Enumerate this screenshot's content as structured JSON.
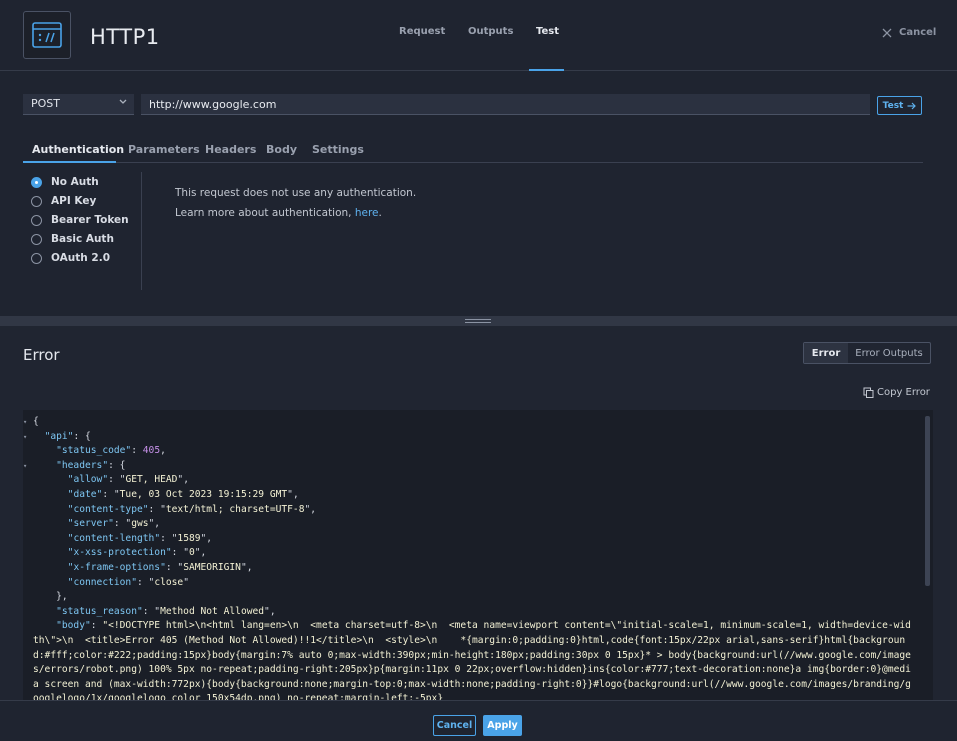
{
  "header": {
    "icon": "http-api-icon",
    "title": "HTTP1",
    "tabs": [
      {
        "label": "Request",
        "active": false
      },
      {
        "label": "Outputs",
        "active": false
      },
      {
        "label": "Test",
        "active": true
      }
    ],
    "cancel_label": "Cancel"
  },
  "request": {
    "method": "POST",
    "url": "http://www.google.com",
    "test_label": "Test"
  },
  "sub_tabs": [
    {
      "label": "Authentication",
      "active": true
    },
    {
      "label": "Parameters",
      "active": false
    },
    {
      "label": "Headers",
      "active": false
    },
    {
      "label": "Body",
      "active": false
    },
    {
      "label": "Settings",
      "active": false
    }
  ],
  "auth": {
    "options": [
      {
        "label": "No Auth",
        "selected": true
      },
      {
        "label": "API Key",
        "selected": false
      },
      {
        "label": "Bearer Token",
        "selected": false
      },
      {
        "label": "Basic Auth",
        "selected": false
      },
      {
        "label": "OAuth 2.0",
        "selected": false
      }
    ],
    "description": "This request does not use any authentication.",
    "learn_more_prefix": "Learn more about authentication, ",
    "learn_more_link": "here",
    "learn_more_suffix": "."
  },
  "error": {
    "title": "Error",
    "toggle": {
      "error": "Error",
      "outputs": "Error Outputs"
    },
    "copy_label": "Copy Error",
    "response": {
      "status_code": "405",
      "headers": [
        {
          "key": "allow",
          "value": "GET, HEAD"
        },
        {
          "key": "date",
          "value": "Tue, 03 Oct 2023 19:15:29 GMT"
        },
        {
          "key": "content-type",
          "value": "text/html; charset=UTF-8"
        },
        {
          "key": "server",
          "value": "gws"
        },
        {
          "key": "content-length",
          "value": "1589"
        },
        {
          "key": "x-xss-protection",
          "value": "0"
        },
        {
          "key": "x-frame-options",
          "value": "SAMEORIGIN"
        },
        {
          "key": "connection",
          "value": "close"
        }
      ],
      "status_reason": "Method Not Allowed",
      "body_text": "\"<!DOCTYPE html>\\n<html lang=en>\\n  <meta charset=utf-8>\\n  <meta name=viewport content=\\\"initial-scale=1, minimum-scale=1, width=device-width\\\">\\n  <title>Error 405 (Method Not Allowed)!!1</title>\\n  <style>\\n    *{margin:0;padding:0}html,code{font:15px/22px arial,sans-serif}html{background:#fff;color:#222;padding:15px}body{margin:7% auto 0;max-width:390px;min-height:180px;padding:30px 0 15px}* > body{background:url(//www.google.com/images/errors/robot.png) 100% 5px no-repeat;padding-right:205px}p{margin:11px 0 22px;overflow:hidden}ins{color:#777;text-decoration:none}a img{border:0}@media screen and (max-width:772px){body{background:none;margin-top:0;max-width:none;padding-right:0}}#logo{background:url(//www.google.com/images/branding/googlelogo/1x/googlelogo_color_150x54dp.png) no-repeat;margin-left:-5px}"
    }
  },
  "footer": {
    "cancel_label": "Cancel",
    "apply_label": "Apply"
  }
}
